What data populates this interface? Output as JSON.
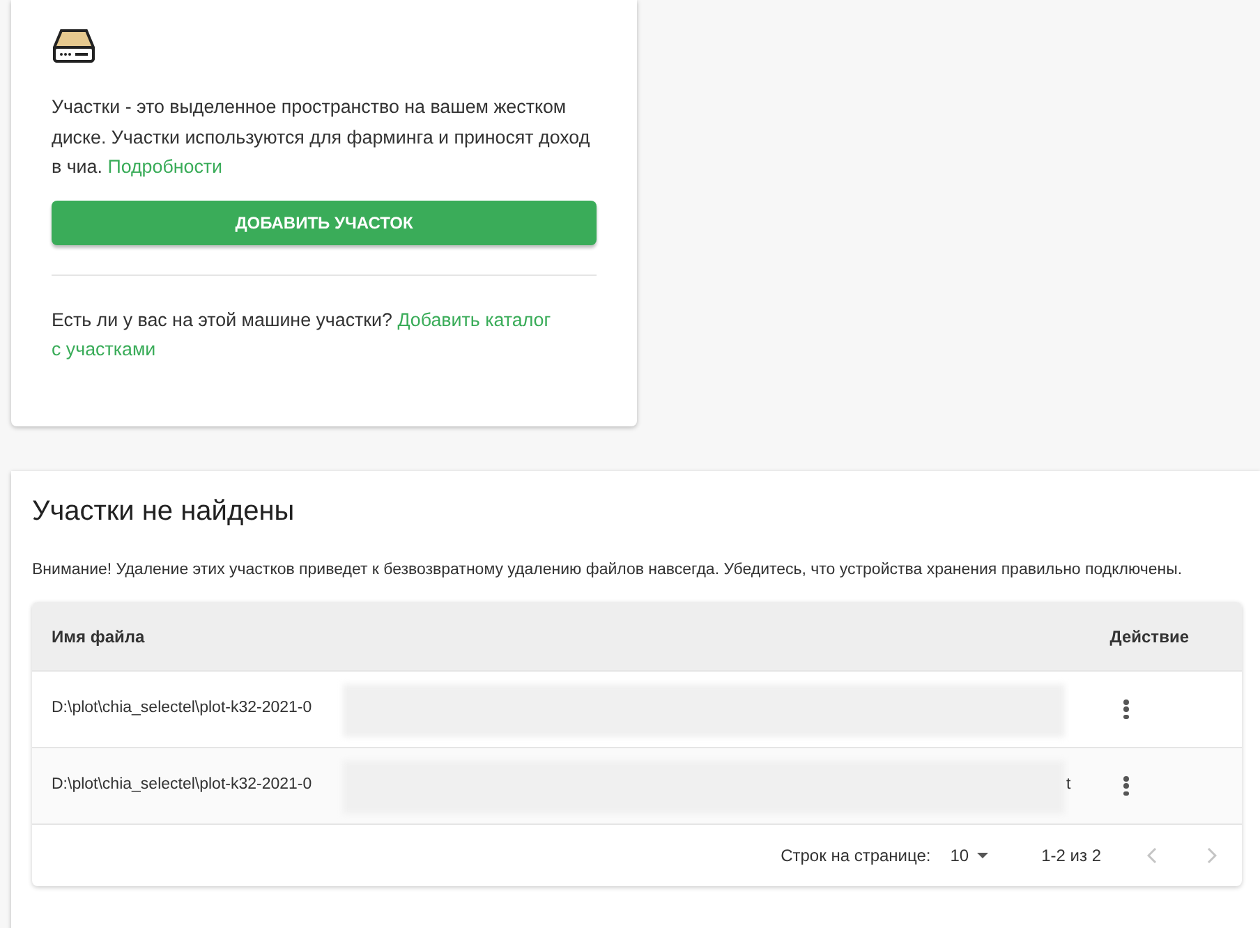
{
  "intro_card": {
    "description": "Участки - это выделенное пространство на вашем жестком диске. Участки используются для фарминга и приносят доход в чиа.",
    "details_link": "Подробности",
    "add_button": "ДОБАВИТЬ УЧАСТОК",
    "question": "Есть ли у вас на этой машине участки?",
    "add_directory_link_lines": [
      "Добавить каталог",
      "с участками"
    ]
  },
  "not_found_card": {
    "title": "Участки не найдены",
    "warning": "Внимание! Удаление этих участков приведет к безвозвратному удалению файлов навсегда. Убедитесь, что устройства хранения правильно подключены.",
    "table": {
      "columns": [
        "Имя файла",
        "Действие"
      ],
      "rows": [
        {
          "file": "D:\\plot\\chia_selectel\\plot-k32-2021-0",
          "tail": ""
        },
        {
          "file": "D:\\plot\\chia_selectel\\plot-k32-2021-0",
          "tail": "t"
        }
      ],
      "pagination": {
        "rows_per_page_label": "Строк на странице:",
        "rows_per_page": "10",
        "range": "1-2 из 2",
        "previous_disabled": true,
        "next_disabled": true
      }
    }
  }
}
